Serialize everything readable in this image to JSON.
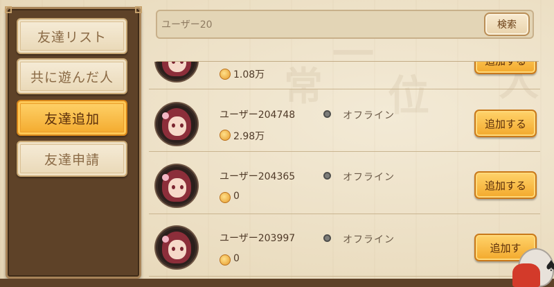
{
  "sidebar": {
    "tabs": [
      {
        "label": "友達リスト",
        "active": false
      },
      {
        "label": "共に遊んだ人",
        "active": false
      },
      {
        "label": "友達追加",
        "active": true
      },
      {
        "label": "友達申請",
        "active": false
      }
    ]
  },
  "search": {
    "value": "ユーザー20",
    "button_label": "検索"
  },
  "rows": [
    {
      "name": "",
      "status": "",
      "coins": "1.08万",
      "add_label": "追加する"
    },
    {
      "name": "ユーザー204748",
      "status": "オフライン",
      "coins": "2.98万",
      "add_label": "追加する"
    },
    {
      "name": "ユーザー204365",
      "status": "オフライン",
      "coins": "0",
      "add_label": "追加する"
    },
    {
      "name": "ユーザー203997",
      "status": "オフライン",
      "coins": "0",
      "add_label": "追加す"
    }
  ],
  "colors": {
    "accent": "#f3a92c",
    "panel": "#5e4228",
    "background": "#efe4cc",
    "status_offline": "#7d7d7a"
  },
  "icons": [
    "coin-icon",
    "status-dot-icon",
    "avatar",
    "daruma-icon"
  ]
}
